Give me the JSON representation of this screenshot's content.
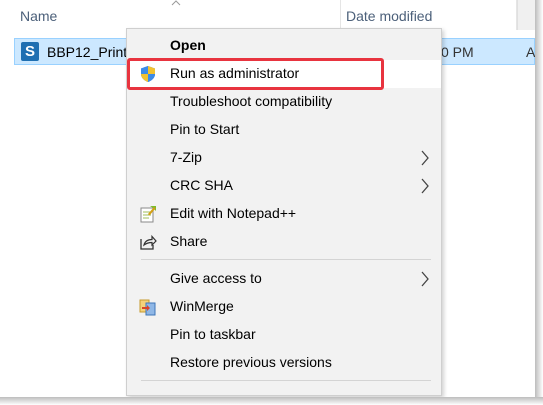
{
  "explorer": {
    "columns": {
      "name": "Name",
      "date_modified": "Date modified"
    },
    "file": {
      "name": "BBP12_Print",
      "time_fragment": "0 PM",
      "extra_fragment": "A"
    }
  },
  "context_menu": {
    "items": [
      {
        "label": "Open",
        "bold": true,
        "icon": "",
        "submenu": false
      },
      {
        "label": "Run as administrator",
        "bold": false,
        "icon": "uac-shield-icon",
        "submenu": false,
        "highlighted": true
      },
      {
        "label": "Troubleshoot compatibility",
        "bold": false,
        "icon": "",
        "submenu": false
      },
      {
        "label": "Pin to Start",
        "bold": false,
        "icon": "",
        "submenu": false
      },
      {
        "label": "7-Zip",
        "bold": false,
        "icon": "",
        "submenu": true
      },
      {
        "label": "CRC SHA",
        "bold": false,
        "icon": "",
        "submenu": true
      },
      {
        "label": "Edit with Notepad++",
        "bold": false,
        "icon": "notepad-plus-plus-icon",
        "submenu": false
      },
      {
        "label": "Share",
        "bold": false,
        "icon": "share-icon",
        "submenu": false
      },
      {
        "label": "Give access to",
        "bold": false,
        "icon": "",
        "submenu": true
      },
      {
        "label": "WinMerge",
        "bold": false,
        "icon": "winmerge-icon",
        "submenu": false
      },
      {
        "label": "Pin to taskbar",
        "bold": false,
        "icon": "",
        "submenu": false
      },
      {
        "label": "Restore previous versions",
        "bold": false,
        "icon": "",
        "submenu": false
      }
    ]
  },
  "colors": {
    "highlight_box": "#e8343f",
    "selection": "#cce8ff",
    "menu_bg": "#f2f2f2"
  }
}
